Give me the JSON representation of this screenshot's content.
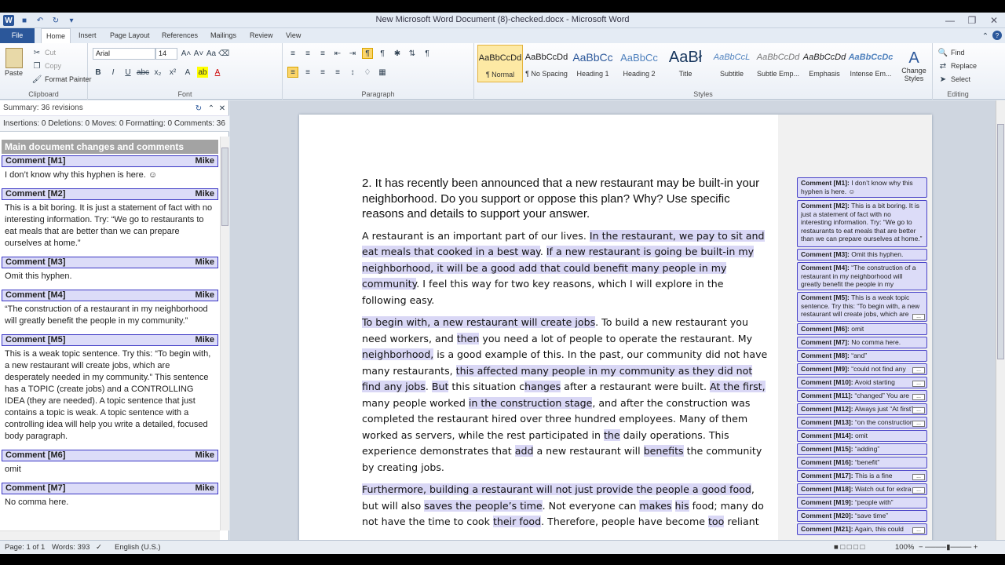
{
  "window": {
    "title": "New Microsoft Word Document (8)-checked.docx - Microsoft Word"
  },
  "tabs": [
    "File",
    "Home",
    "Insert",
    "Page Layout",
    "References",
    "Mailings",
    "Review",
    "View"
  ],
  "ribbon": {
    "clipboard": {
      "paste": "Paste",
      "cut": "Cut",
      "copy": "Copy",
      "format_painter": "Format Painter",
      "label": "Clipboard"
    },
    "font": {
      "name": "Arial",
      "size": "14",
      "label": "Font"
    },
    "paragraph": {
      "label": "Paragraph"
    },
    "styles": {
      "label": "Styles",
      "items": [
        {
          "preview": "AaBbCcDd",
          "name": "¶ Normal"
        },
        {
          "preview": "AaBbCcDd",
          "name": "¶ No Spacing"
        },
        {
          "preview": "AaBbCc",
          "name": "Heading 1"
        },
        {
          "preview": "AaBbCc",
          "name": "Heading 2"
        },
        {
          "preview": "AaBł",
          "name": "Title"
        },
        {
          "preview": "AaBbCcL",
          "name": "Subtitle"
        },
        {
          "preview": "AaBbCcDd",
          "name": "Subtle Emp..."
        },
        {
          "preview": "AaBbCcDd",
          "name": "Emphasis"
        },
        {
          "preview": "AaBbCcDc",
          "name": "Intense Em..."
        }
      ],
      "change_styles": "Change Styles"
    },
    "editing": {
      "find": "Find",
      "replace": "Replace",
      "select": "Select",
      "label": "Editing"
    }
  },
  "pane": {
    "summary": "Summary: 36 revisions",
    "stats": "Insertions: 0  Deletions: 0  Moves: 0  Formatting: 0  Comments: 36",
    "section": "Main document changes and comments",
    "comments": [
      {
        "id": "Comment [M1]",
        "author": "Mike",
        "text": "I don’t know why this hyphen is here. ☺"
      },
      {
        "id": "Comment [M2]",
        "author": "Mike",
        "text": "This is a bit boring.  It is just a statement of fact with no interesting information.  Try:  “We go to restaurants to eat meals that are better than we can prepare ourselves at home.”"
      },
      {
        "id": "Comment [M3]",
        "author": "Mike",
        "text": "Omit this hyphen."
      },
      {
        "id": "Comment [M4]",
        "author": "Mike",
        "text": "“The construction of a restaurant in my neighborhood will greatly benefit the people in my community.”"
      },
      {
        "id": "Comment [M5]",
        "author": "Mike",
        "text": "This is a weak topic sentence.  Try this:  “To begin with, a new restaurant will create jobs, which are desperately needed in my community.”  This sentence has a TOPIC (create jobs) and a CONTROLLING IDEA (they are needed).   A topic sentence that just contains a topic is weak.  A topic sentence with a controlling idea will help you write a detailed, focused body paragraph."
      },
      {
        "id": "Comment [M6]",
        "author": "Mike",
        "text": "omit"
      },
      {
        "id": "Comment [M7]",
        "author": "Mike",
        "text": "No comma here."
      }
    ]
  },
  "document": {
    "question": "2.    It has recently been announced that a new restaurant may be built-in your neighborhood. Do you support or oppose this plan? Why? Use specific reasons and details to support your answer.",
    "p1": {
      "a": "A restaurant is an important part of our lives. ",
      "b": "In the restaurant, we pay to sit and eat meals that cooked in a best way",
      "c": ". ",
      "d": "If a new restaurant is going be built-in my neighborhood, it will be a good add that could benefit many people in my community",
      "e": ". I feel this way for two key reasons, which I will explore in the following  easy."
    },
    "p2": {
      "a": "To begin with, a new restaurant will create jobs",
      "b": ". To build a new restaurant you need workers, and ",
      "c": "then",
      "d": " you need a lot of people to operate the restaurant. My ",
      "e": "neighborhood,",
      "f": " is a good example of this. In the past, our community did not have many restaurants, ",
      "g": "this affected many people in my community as they ",
      "h": "did not find any jobs",
      "i": ". ",
      "j": "But",
      "k": " this situation c",
      "l": "hanges",
      "m": " after a restaurant were built. ",
      "n": "At the first,",
      "o": " many people worked ",
      "p": "in the construction stage",
      "q": ", and after the construction was completed the restaurant hired over three hundred employees.  Many of them worked as servers, while the rest participated in ",
      "r": "the",
      "s": " daily operations. This experience demonstrates that ",
      "t": "add",
      "u": " a new restaurant will ",
      "v": "benefits",
      "w": " the community by creating jobs."
    },
    "p3": {
      "a": "Furthermore, ",
      "b": "building a restaurant will not just provide ",
      "c": "the people a ",
      "d": "good food",
      "e": ", but will also ",
      "f": "saves the people’s time",
      "g": ". Not everyone can ",
      "h": "makes",
      "i": " ",
      "j": "his",
      "k": " food; many do not have the time to cook ",
      "l": "their food",
      "m": ". Therefore, people have become ",
      "n": "too",
      "o": " reliant"
    }
  },
  "balloons": [
    {
      "label": "Comment [M1]:",
      "text": "I don’t know why this hyphen is here. ☺",
      "more": false
    },
    {
      "label": "Comment [M2]:",
      "text": "This is a bit boring.  It is just a statement of fact with no interesting information.  Try:  “We go to restaurants to eat meals that are better than we can prepare ourselves at home.”",
      "more": false
    },
    {
      "label": "Comment [M3]:",
      "text": "Omit this hyphen.",
      "more": false
    },
    {
      "label": "Comment [M4]:",
      "text": "“The construction of a restaurant in my neighborhood will greatly benefit the people in my community.”",
      "more": false
    },
    {
      "label": "Comment [M5]:",
      "text": "This is a weak topic sentence.  Try this:  “To begin with, a new restaurant will create jobs, which are",
      "more": true
    },
    {
      "label": "Comment [M6]:",
      "text": "omit",
      "more": false
    },
    {
      "label": "Comment [M7]:",
      "text": "No comma here.",
      "more": false
    },
    {
      "label": "Comment [M8]:",
      "text": "“and”",
      "more": false
    },
    {
      "label": "Comment [M9]:",
      "text": "“could not find any",
      "more": true
    },
    {
      "label": "Comment [M10]:",
      "text": "Avoid starting",
      "more": true
    },
    {
      "label": "Comment [M11]:",
      "text": "“changed”  You are",
      "more": true
    },
    {
      "label": "Comment [M12]:",
      "text": "Always just “At first”",
      "more": true
    },
    {
      "label": "Comment [M13]:",
      "text": "“on the construction",
      "more": true
    },
    {
      "label": "Comment [M14]:",
      "text": "omit",
      "more": false
    },
    {
      "label": "Comment [M15]:",
      "text": "“adding”",
      "more": false
    },
    {
      "label": "Comment [M16]:",
      "text": "“benefit”",
      "more": false
    },
    {
      "label": "Comment [M17]:",
      "text": "This is a fine",
      "more": true
    },
    {
      "label": "Comment [M18]:",
      "text": "Watch out for extra",
      "more": true
    },
    {
      "label": "Comment [M19]:",
      "text": "“people with”",
      "more": false
    },
    {
      "label": "Comment [M20]:",
      "text": "“save time”",
      "more": false
    },
    {
      "label": "Comment [M21]:",
      "text": "Again, this could",
      "more": true
    }
  ],
  "status": {
    "page": "Page: 1 of 1",
    "words": "Words: 393",
    "language": "English (U.S.)",
    "zoom": "100%"
  },
  "colors": {
    "accent": "#2b579a",
    "comment_fill": "#dcdcf8",
    "comment_border": "#3a36c4"
  }
}
